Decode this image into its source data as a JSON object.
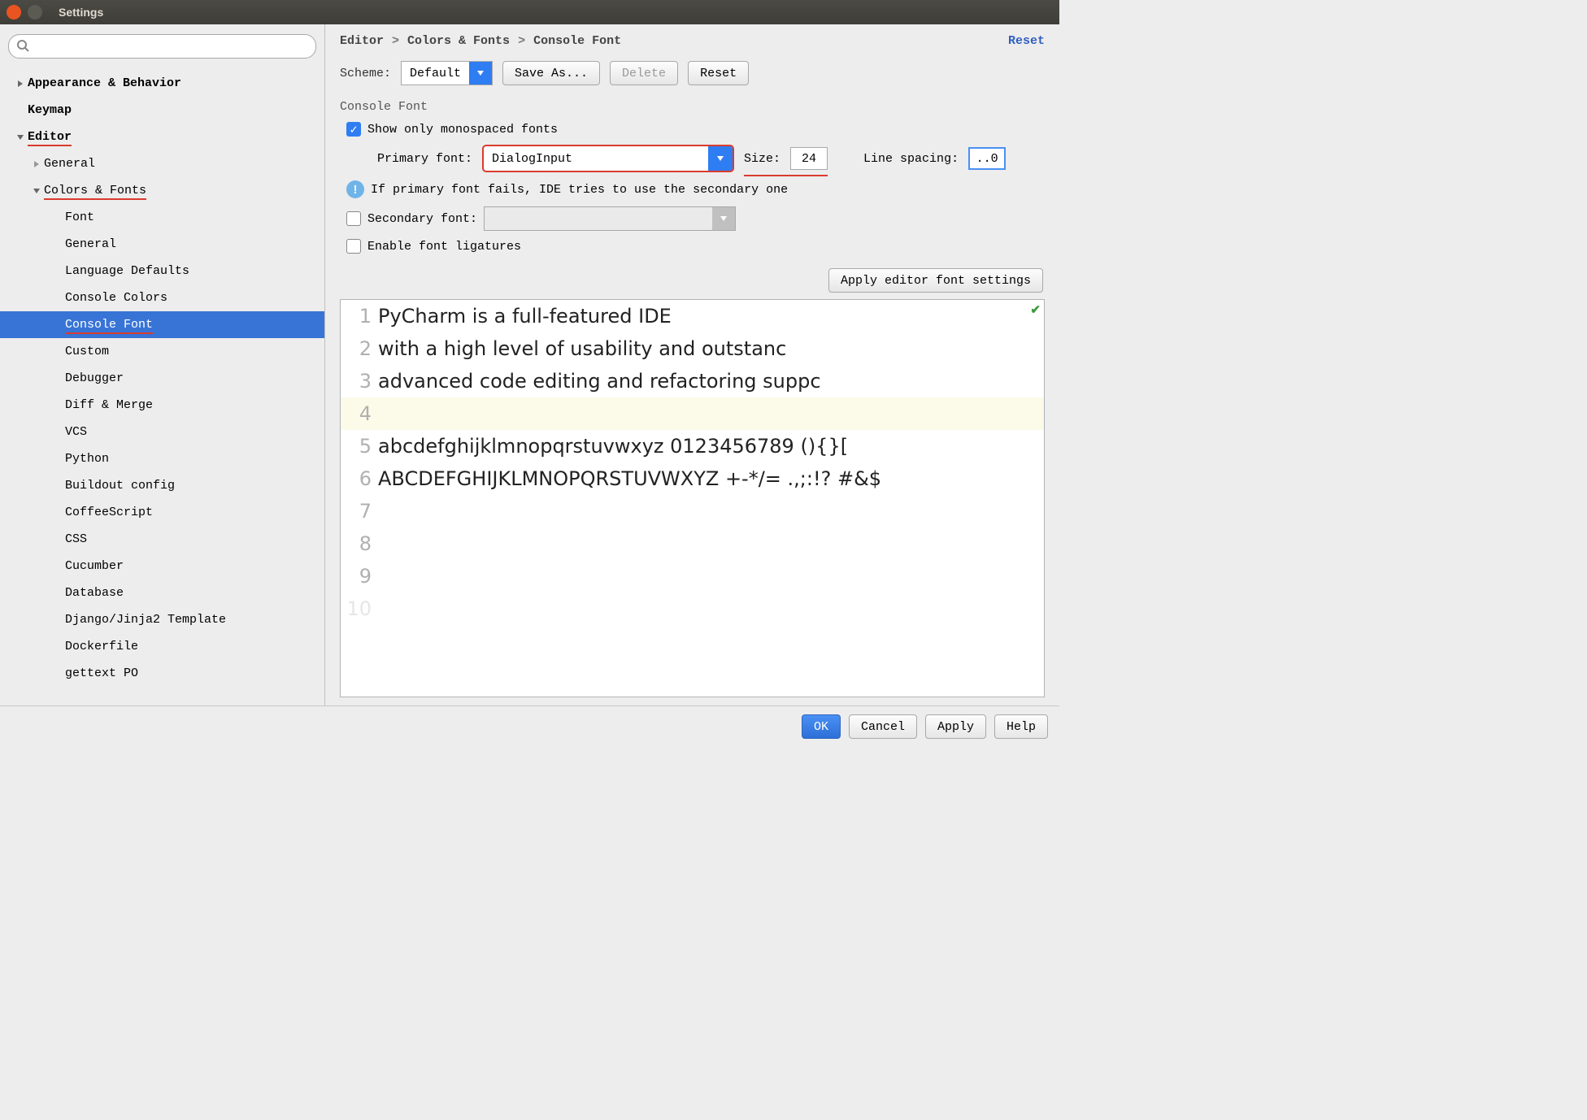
{
  "window_title": "Settings",
  "search_placeholder": "",
  "tree": {
    "appearance": "Appearance & Behavior",
    "keymap": "Keymap",
    "editor": "Editor",
    "general": "General",
    "colors_fonts": "Colors & Fonts",
    "items": {
      "font": "Font",
      "general2": "General",
      "lang_defaults": "Language Defaults",
      "console_colors": "Console Colors",
      "console_font": "Console Font",
      "custom": "Custom",
      "debugger": "Debugger",
      "diff_merge": "Diff & Merge",
      "vcs": "VCS",
      "python": "Python",
      "buildout": "Buildout config",
      "coffee": "CoffeeScript",
      "css": "CSS",
      "cucumber": "Cucumber",
      "database": "Database",
      "django": "Django/Jinja2 Template",
      "dockerfile": "Dockerfile",
      "gettext": "gettext PO"
    }
  },
  "breadcrumb": {
    "editor": "Editor",
    "colors_fonts": "Colors & Fonts",
    "console_font": "Console Font",
    "reset": "Reset"
  },
  "scheme": {
    "label": "Scheme:",
    "value": "Default",
    "save_as": "Save As...",
    "delete": "Delete",
    "reset": "Reset"
  },
  "section": {
    "title": "Console Font",
    "mono_checkbox": "Show only monospaced fonts",
    "primary_label": "Primary font:",
    "primary_value": "DialogInput",
    "size_label": "Size:",
    "size_value": "24",
    "line_spacing_label": "Line spacing:",
    "line_spacing_value": "..0",
    "info_text": "If primary font fails, IDE tries to use the secondary one",
    "secondary_label": "Secondary font:",
    "ligatures": "Enable font ligatures",
    "apply_editor": "Apply editor font settings"
  },
  "preview": {
    "l1": "PyCharm is a full-featured IDE",
    "l2": "with a high level of usability and outstanc",
    "l3": "advanced code editing and refactoring suppc",
    "l4": "",
    "l5": "abcdefghijklmnopqrstuvwxyz 0123456789 (){}[",
    "l6": "ABCDEFGHIJKLMNOPQRSTUVWXYZ +-*/= .,;:!? #&$"
  },
  "footer": {
    "ok": "OK",
    "cancel": "Cancel",
    "apply": "Apply",
    "help": "Help"
  }
}
